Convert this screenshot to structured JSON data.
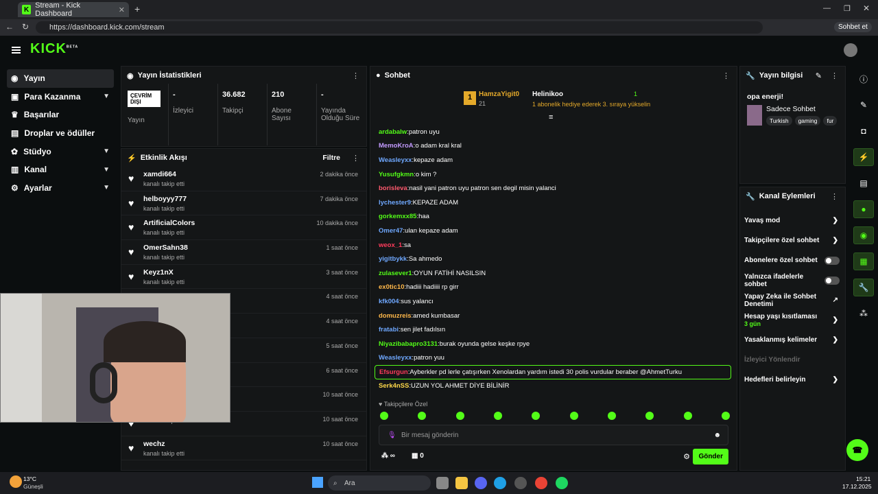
{
  "browser": {
    "tab_title": "Stream - Kick Dashboard",
    "url": "https://dashboard.kick.com/stream",
    "copilot": "Sohbet et"
  },
  "logo": {
    "text": "KICK",
    "badge": "BETA"
  },
  "sidebar": {
    "items": [
      {
        "label": "Yayın"
      },
      {
        "label": "Para Kazanma"
      },
      {
        "label": "Başarılar"
      },
      {
        "label": "Droplar ve ödüller"
      },
      {
        "label": "Stüdyo"
      },
      {
        "label": "Kanal"
      },
      {
        "label": "Ayarlar"
      }
    ]
  },
  "stats": {
    "title": "Yayın İstatistikleri",
    "status": "ÇEVRİM DIŞI",
    "status_label": "Yayın",
    "items": [
      {
        "value": "-",
        "label": "İzleyici"
      },
      {
        "value": "36.682",
        "label": "Takipçi"
      },
      {
        "value": "210",
        "label": "Abone Sayısı"
      },
      {
        "value": "-",
        "label": "Yayında Olduğu Süre"
      }
    ]
  },
  "activity": {
    "title": "Etkinlik Akışı",
    "filter": "Filtre",
    "rows": [
      {
        "name": "xamdi664",
        "sub": "kanalı takip etti",
        "time": "2 dakika önce"
      },
      {
        "name": "helboyyy777",
        "sub": "kanalı takip etti",
        "time": "7 dakika önce"
      },
      {
        "name": "ArtificialColors",
        "sub": "kanalı takip etti",
        "time": "10 dakika önce"
      },
      {
        "name": "OmerSahn38",
        "sub": "kanalı takip etti",
        "time": "1 saat önce"
      },
      {
        "name": "Keyz1nX",
        "sub": "kanalı takip etti",
        "time": "3 saat önce"
      },
      {
        "name": "",
        "sub": "",
        "time": "4 saat önce"
      },
      {
        "name": "",
        "sub": "",
        "time": "4 saat önce"
      },
      {
        "name": "",
        "sub": "",
        "time": "5 saat önce"
      },
      {
        "name": "",
        "sub": "",
        "time": "6 saat önce"
      },
      {
        "name": "",
        "sub": "",
        "time": "10 saat önce"
      },
      {
        "name": "",
        "sub": "kanalı takip etti",
        "time": "10 saat önce"
      },
      {
        "name": "wechz",
        "sub": "kanalı takip etti",
        "time": "10 saat önce"
      }
    ]
  },
  "chat": {
    "title": "Sohbet",
    "pin_user": "HamzaYigit0",
    "pin_count": "21",
    "pin_user2": "Helinikoo",
    "pin_num": "1",
    "pin_text": "1 abonelik hediye ederek 3. sıraya yükselin",
    "messages": [
      {
        "user": "ardabalw",
        "text": "patron uyu",
        "color": "#53fc18"
      },
      {
        "user": "MemoKroA",
        "text": "o adam kral kral",
        "color": "#c39bff"
      },
      {
        "user": "Weasleyxx",
        "text": "kepaze adam",
        "color": "#6fa8ff"
      },
      {
        "user": "Yusufgkmn",
        "text": "o kim ?",
        "color": "#53fc18"
      },
      {
        "user": "borisleva",
        "text": "nasil yani patron uyu patron sen degil misin yalanci",
        "color": "#ff5a6e"
      },
      {
        "user": "lychester9",
        "text": "KEPAZE ADAM",
        "color": "#6fa8ff"
      },
      {
        "user": "gorkemxx85",
        "text": "haa",
        "color": "#53fc18"
      },
      {
        "user": "Omer47",
        "text": "ulan kepaze adam",
        "color": "#6fa8ff"
      },
      {
        "user": "weox_1",
        "text": "sa",
        "color": "#ff3b5c"
      },
      {
        "user": "yigitbykk",
        "text": "Sa ahmedo",
        "color": "#6fa8ff"
      },
      {
        "user": "zulasever1",
        "text": "OYUN FATİHİ NASILSIN",
        "color": "#53fc18"
      },
      {
        "user": "ex0tic10",
        "text": "hadiii hadiiii rp girr",
        "color": "#ffb84a"
      },
      {
        "user": "kfk004",
        "text": "sus yalancı",
        "color": "#6fa8ff"
      },
      {
        "user": "domuzreis",
        "text": "amed kumbasar",
        "color": "#ffb84a"
      },
      {
        "user": "fratabi",
        "text": "sen jilet fadılsın",
        "color": "#6fa8ff"
      },
      {
        "user": "Niyazibabapro3131",
        "text": "burak oyunda gelse keşke rpye",
        "color": "#53fc18"
      },
      {
        "user": "Weasleyxx",
        "text": "patron yuu",
        "color": "#6fa8ff"
      },
      {
        "user": "Efsurgun",
        "text": "Ayberkler pd lerle çatışırken Xenolardan yardım istedi 30 polis vurdular beraber @AhmetTurku",
        "color": "#ff3b5c"
      },
      {
        "user": "Serk4nSS",
        "text": "UZUN YOL AHMET DİYE BİLİNİR",
        "color": "#ffd84a"
      }
    ],
    "followers_only": "Takipçilere Özel",
    "placeholder": "Bir mesaj gönderin",
    "send": "Gönder",
    "points": "0"
  },
  "stream_info": {
    "title": "Yayın bilgisi",
    "name": "opa enerji!",
    "category": "Sadece Sohbet",
    "tags": [
      "Turkish",
      "gaming",
      "fur"
    ]
  },
  "channel_actions": {
    "title": "Kanal Eylemleri",
    "items": [
      {
        "label": "Yavaş mod",
        "ctrl": "arrow"
      },
      {
        "label": "Takipçilere özel sohbet",
        "ctrl": "arrow"
      },
      {
        "label": "Abonelere özel sohbet",
        "ctrl": "toggle"
      },
      {
        "label": "Yalnızca ifadelerle sohbet",
        "ctrl": "toggle"
      },
      {
        "label": "Yapay Zeka ile Sohbet Denetimi",
        "ctrl": "ext"
      },
      {
        "label": "Hesap yaşı kısıtlaması",
        "sub": "3 gün",
        "ctrl": "arrow"
      },
      {
        "label": "Yasaklanmış kelimeler",
        "ctrl": "arrow"
      },
      {
        "label": "İzleyici Yönlendir",
        "ctrl": "none",
        "dim": true
      },
      {
        "label": "Hedefleri belirleyin",
        "ctrl": "arrow"
      }
    ]
  },
  "taskbar": {
    "temp": "13°C",
    "weather": "Güneşli",
    "search": "Ara",
    "time": "15:21",
    "date": "17.12.2025"
  }
}
